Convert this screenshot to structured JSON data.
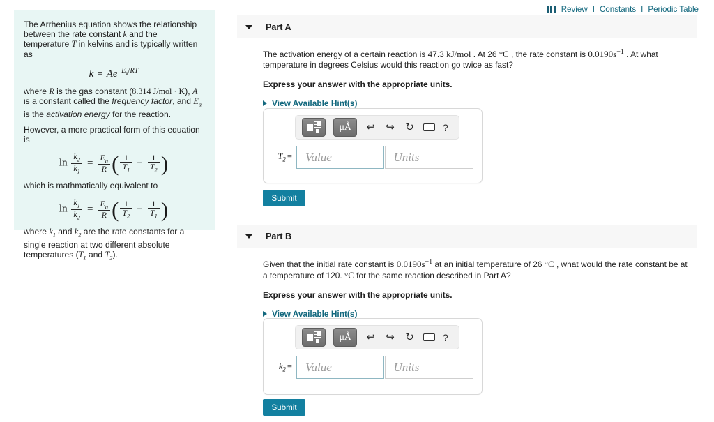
{
  "topnav": {
    "icon": "book-columns-icon",
    "review": "Review",
    "constants": "Constants",
    "periodic_table": "Periodic Table",
    "separator": "I",
    "link_color": "#13687e"
  },
  "info_panel": {
    "background_color": "#e8f6f4",
    "para1_a": "The Arrhenius equation shows the relationship between the rate constant ",
    "para1_k": "k",
    "para1_b": " and the temperature ",
    "para1_T": "T",
    "para1_c": " in kelvins and is typically written as",
    "equation1": "k = Ae^(-Ea/RT)",
    "para2_a": "where ",
    "para2_R": "R",
    "para2_b": " is the gas constant (8.314 J/mol · K), ",
    "para2_A": "A",
    "para2_c": " is a constant called the ",
    "para2_ital1": "frequency factor",
    "para2_d": ", and ",
    "para2_Ea": "Ea",
    "para2_e": " is the ",
    "para2_ital2": "activation energy",
    "para2_f": " for the reaction.",
    "para3": "However, a more practical form of this equation is",
    "equation2": "ln (k2/k1) = (Ea/R)(1/T1 - 1/T2)",
    "para4": "which is mathmatically equivalent to",
    "equation3": "ln (k1/k2) = (Ea/R)(1/T2 - 1/T1)",
    "para5_a": "where ",
    "para5_k1": "k1",
    "para5_b": " and ",
    "para5_k2": "k2",
    "para5_c": " are the rate constants for a single reaction at two different absolute temperatures (",
    "para5_T1": "T1",
    "para5_d": " and ",
    "para5_T2": "T2",
    "para5_e": ")."
  },
  "parts": [
    {
      "id": "part-a",
      "title": "Part A",
      "question_1": "The activation energy of a certain reaction is 47.3 ",
      "question_unit_1": "kJ/mol",
      "question_2": " . At 26 ",
      "question_unit_2": "°C",
      "question_3": " , the rate constant is ",
      "question_value": "0.0190s",
      "question_exp": "−1",
      "question_4": " . At what temperature in degrees Celsius would this reaction go twice as fast?",
      "instruction": "Express your answer with the appropriate units.",
      "hint_label": "View Available Hint(s)",
      "variable": "T",
      "variable_sub": "2",
      "equals": "=",
      "value_placeholder": "Value",
      "units_placeholder": "Units",
      "submit_label": "Submit",
      "toolbar": {
        "template_button": "template-icon",
        "units_button": "μÅ",
        "undo": "↩",
        "redo": "↪",
        "reset": "↻",
        "keyboard": "keyboard-icon",
        "help": "?"
      }
    },
    {
      "id": "part-b",
      "title": "Part B",
      "question_1": "Given that the initial rate constant is ",
      "question_value": "0.0190s",
      "question_exp": "−1",
      "question_2": " at an initial temperature of 26 ",
      "question_unit_1": "°C",
      "question_3": " , what would the rate constant be at a temperature of 120. ",
      "question_unit_2": "°C",
      "question_4": " for the same reaction described in Part A?",
      "instruction": "Express your answer with the appropriate units.",
      "hint_label": "View Available Hint(s)",
      "variable": "k",
      "variable_sub": "2",
      "equals": "=",
      "value_placeholder": "Value",
      "units_placeholder": "Units",
      "submit_label": "Submit",
      "toolbar": {
        "template_button": "template-icon",
        "units_button": "μÅ",
        "undo": "↩",
        "redo": "↪",
        "reset": "↻",
        "keyboard": "keyboard-icon",
        "help": "?"
      }
    }
  ],
  "theme": {
    "accent": "#1380a0",
    "link": "#13687e",
    "header_band": "#f7f7f7",
    "panel": "#e8f6f4",
    "divider": "#b9ccdb"
  }
}
